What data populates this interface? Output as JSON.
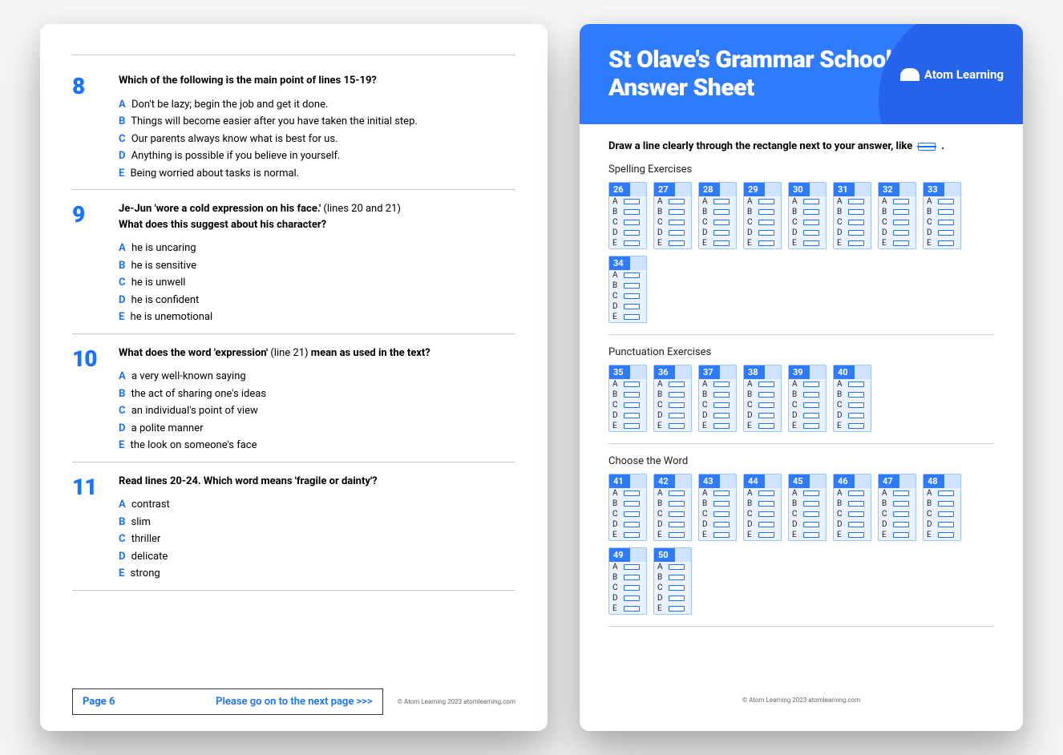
{
  "left": {
    "questions": [
      {
        "num": "8",
        "title": "Which of the following is the main point of lines 15-19?",
        "options": [
          "Don't be lazy; begin the job and get it done.",
          "Things will become easier after you have taken the initial step.",
          "Our parents always know what is best for us.",
          "Anything is possible if you believe in yourself.",
          "Being worried about tasks is normal."
        ]
      },
      {
        "num": "9",
        "title_pre": "Je-Jun 'wore a cold expression on his face.' ",
        "title_norm": "(lines 20 and 21)",
        "title2": "What does this suggest about his character?",
        "options": [
          "he is uncaring",
          "he is sensitive",
          "he is unwell",
          "he is confident",
          "he is unemotional"
        ]
      },
      {
        "num": "10",
        "title_parts": [
          "What does the word 'expression' ",
          "(line 21)",
          " mean as used in the text?"
        ],
        "options": [
          "a very well-known saying",
          "the act of sharing one's ideas",
          "an individual's point of view",
          "a polite manner",
          "the look on someone's face"
        ]
      },
      {
        "num": "11",
        "title": "Read lines 20-24. Which word means 'fragile or dainty'?",
        "options": [
          "contrast",
          "slim",
          "thriller",
          "delicate",
          "strong"
        ]
      }
    ],
    "letters": [
      "A",
      "B",
      "C",
      "D",
      "E"
    ],
    "page_label": "Page 6",
    "next_label": "Please go on to the next page >>>",
    "copyright": "© Atom Learning 2023   atomlearning.com"
  },
  "right": {
    "title_line1": "St Olave's Grammar School SET",
    "title_line2": "Answer Sheet",
    "logo": "Atom Learning",
    "instruction_pre": "Draw a line clearly through the rectangle next to your answer, like",
    "instruction_post": ".",
    "sections": [
      {
        "title": "Spelling Exercises",
        "start": 26,
        "count": 9
      },
      {
        "title": "Punctuation Exercises",
        "start": 35,
        "count": 6
      },
      {
        "title": "Choose the Word",
        "start": 41,
        "count": 10
      }
    ],
    "letters": [
      "A",
      "B",
      "C",
      "D",
      "E"
    ],
    "copyright": "© Atom Learning 2023   atomlearning.com"
  }
}
